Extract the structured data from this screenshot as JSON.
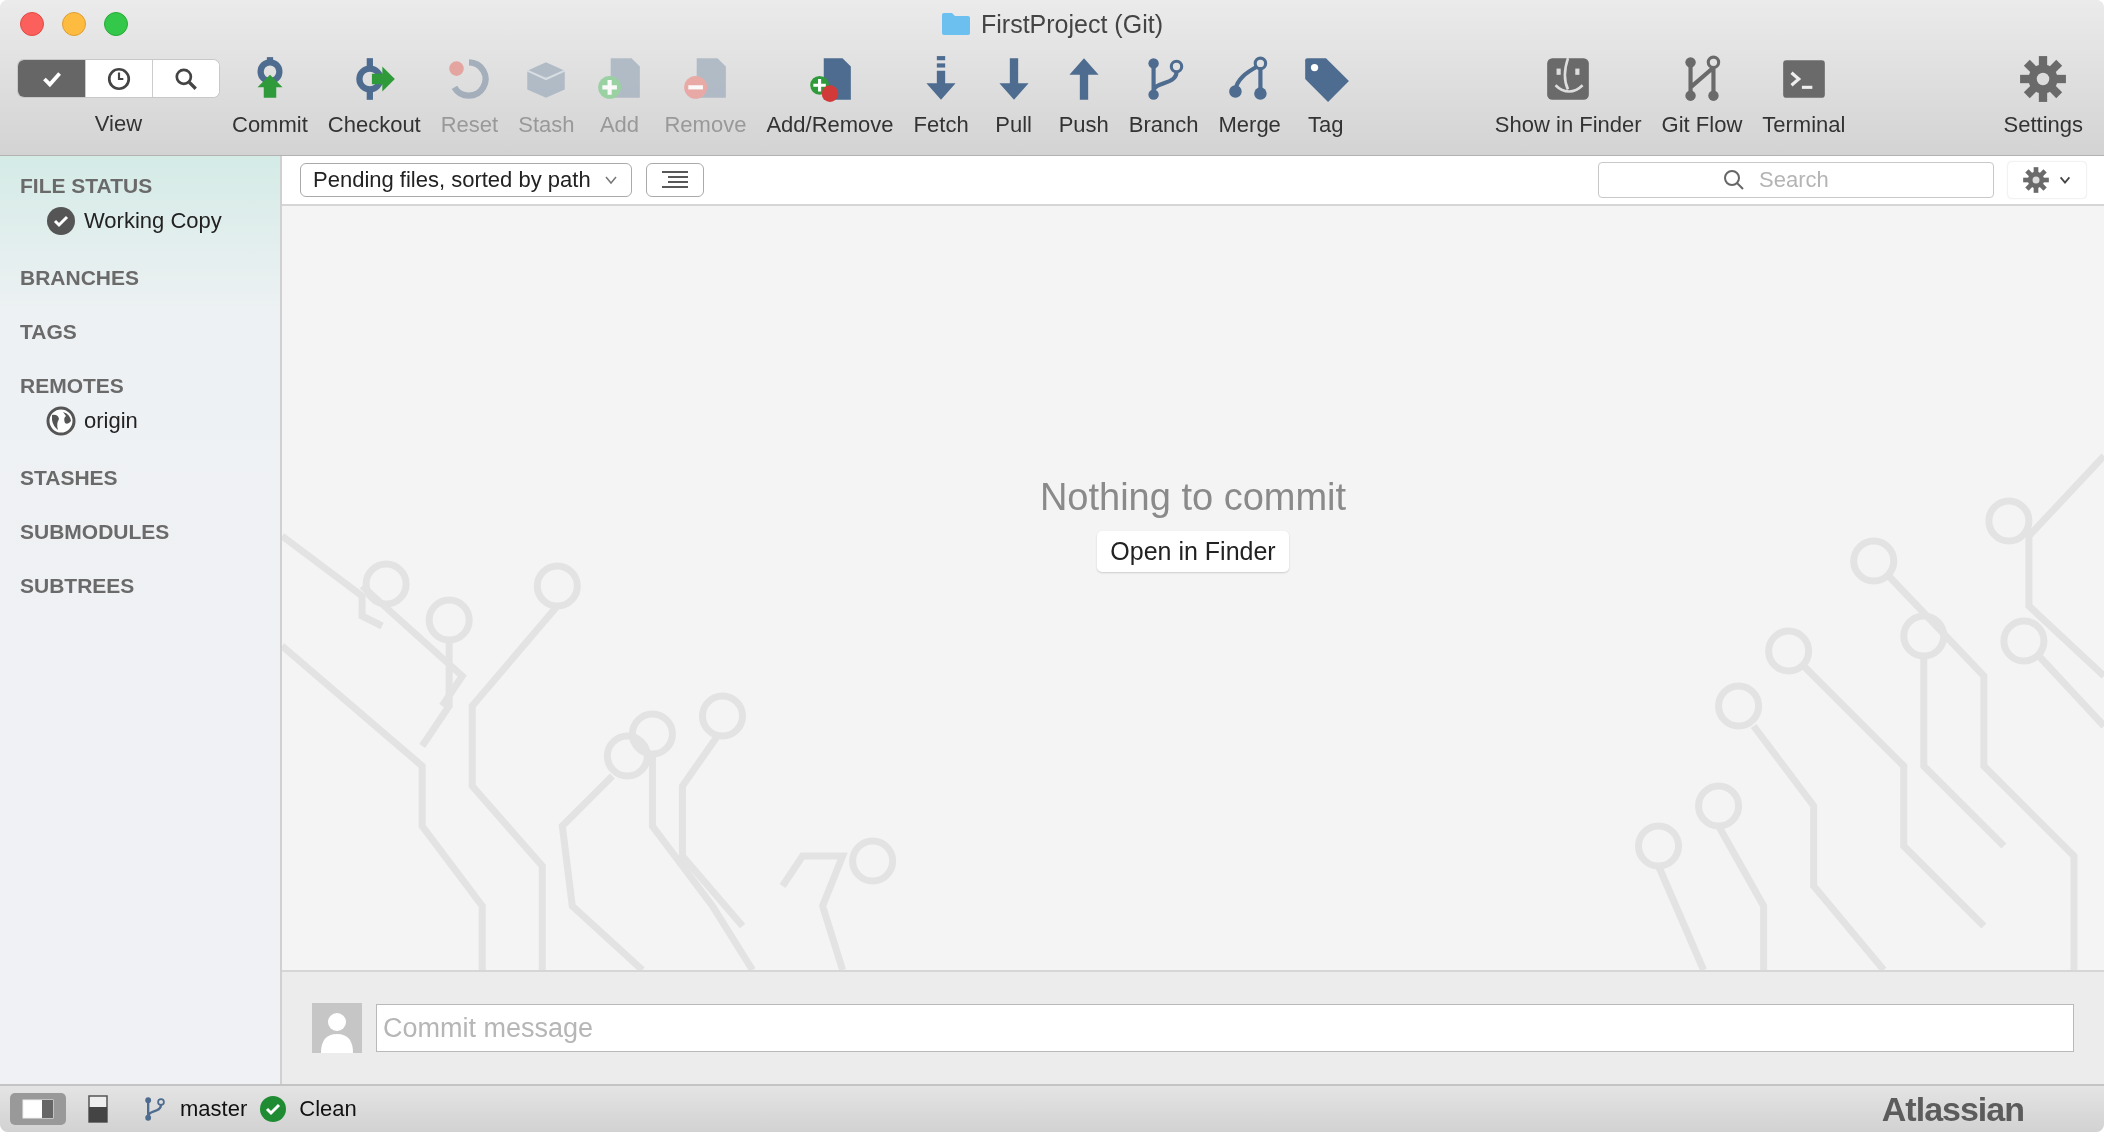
{
  "window": {
    "title": "FirstProject (Git)"
  },
  "toolbar": {
    "view": {
      "label": "View",
      "segments": [
        {
          "selected": true
        },
        {
          "selected": false
        },
        {
          "selected": false
        }
      ]
    },
    "groups": [
      {
        "buttons": [
          {
            "label": "Commit",
            "disabled": false
          },
          {
            "label": "Checkout",
            "disabled": false
          },
          {
            "label": "Reset",
            "disabled": true
          },
          {
            "label": "Stash",
            "disabled": true
          },
          {
            "label": "Add",
            "disabled": true
          },
          {
            "label": "Remove",
            "disabled": true
          },
          {
            "label": "Add/Remove",
            "disabled": false
          },
          {
            "label": "Fetch",
            "disabled": false
          },
          {
            "label": "Pull",
            "disabled": false
          },
          {
            "label": "Push",
            "disabled": false
          },
          {
            "label": "Branch",
            "disabled": false
          },
          {
            "label": "Merge",
            "disabled": false
          },
          {
            "label": "Tag",
            "disabled": false
          }
        ]
      },
      {
        "buttons": [
          {
            "label": "Show in Finder",
            "disabled": false
          },
          {
            "label": "Git Flow",
            "disabled": false
          },
          {
            "label": "Terminal",
            "disabled": false
          }
        ]
      },
      {
        "buttons": [
          {
            "label": "Settings",
            "disabled": false
          }
        ]
      }
    ]
  },
  "sidebar": {
    "sections": [
      {
        "title": "FILE STATUS",
        "items": [
          {
            "label": "Working Copy",
            "kind": "status"
          }
        ]
      },
      {
        "title": "BRANCHES"
      },
      {
        "title": "TAGS"
      },
      {
        "title": "REMOTES",
        "items": [
          {
            "label": "origin",
            "kind": "remote"
          }
        ]
      },
      {
        "title": "STASHES"
      },
      {
        "title": "SUBMODULES"
      },
      {
        "title": "SUBTREES"
      }
    ]
  },
  "filter_bar": {
    "dropdown": "Pending files, sorted by path",
    "search": {
      "placeholder": "Search"
    }
  },
  "main": {
    "message": "Nothing to commit",
    "button": "Open in Finder"
  },
  "commit": {
    "placeholder": "Commit message"
  },
  "status_bar": {
    "branch": "master",
    "state": "Clean",
    "brand": "Atlassian"
  }
}
